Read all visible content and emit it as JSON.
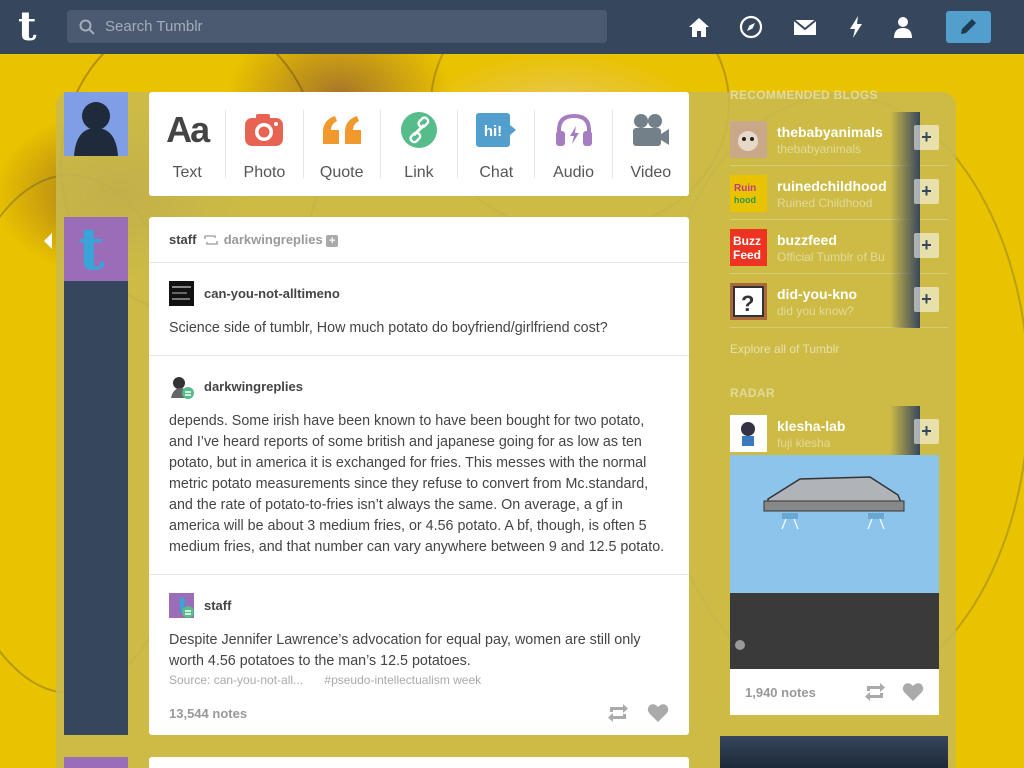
{
  "header": {
    "logo": "t",
    "search_placeholder": "Search Tumblr",
    "nav": [
      "home-icon",
      "explore-icon",
      "inbox-icon",
      "activity-icon",
      "account-icon"
    ],
    "compose": "pencil-icon",
    "bg_color": "#36465d",
    "accent": "#529ecc"
  },
  "post_types": [
    {
      "label": "Text",
      "icon": "text-icon",
      "color": "#444444"
    },
    {
      "label": "Photo",
      "icon": "photo-icon",
      "color": "#e86452"
    },
    {
      "label": "Quote",
      "icon": "quote-icon",
      "color": "#f2992e"
    },
    {
      "label": "Link",
      "icon": "link-icon",
      "color": "#56bc8a"
    },
    {
      "label": "Chat",
      "icon": "chat-icon",
      "color": "#529ecc"
    },
    {
      "label": "Audio",
      "icon": "audio-icon",
      "color": "#a77dc2"
    },
    {
      "label": "Video",
      "icon": "video-icon",
      "color": "#748089"
    }
  ],
  "post": {
    "author": "staff",
    "reblogged_from": "darkwingreplies",
    "trail": [
      {
        "name": "can-you-not-alltimeno",
        "body": "Science side of tumblr, How much potato do boyfriend/girlfriend cost?"
      },
      {
        "name": "darkwingreplies",
        "body": "depends. Some irish have been known to have been bought for two potato, and I’ve heard reports of some british and japanese going for as low as ten potato, but in america it is exchanged for fries. This messes with the normal metric potato measurements since they refuse to convert from Mc.standard, and the rate of potato-to-fries isn’t always the same. On average, a gf in america will be about 3 medium fries, or 4.56 potato. A bf, though, is often 5 medium fries, and that number can vary anywhere between 9 and 12.5 potato."
      },
      {
        "name": "staff",
        "body": "Despite Jennifer Lawrence’s advocation for equal pay, women are still only worth 4.56 potatoes to the man’s 12.5 potatoes."
      }
    ],
    "source": "Source: can-you-not-all...",
    "tag": "#pseudo-intellectualism week",
    "notes": "13,544 notes"
  },
  "sidebar": {
    "recommended_title": "RECOMMENDED BLOGS",
    "blogs": [
      {
        "name": "thebabyanimals",
        "sub": "thebabyanimals"
      },
      {
        "name": "ruinedchildhood",
        "sub": "Ruined Childhood"
      },
      {
        "name": "buzzfeed",
        "sub": "Official Tumblr of Bu"
      },
      {
        "name": "did-you-kno",
        "sub": "did you know?"
      }
    ],
    "follow_label": "+",
    "explore": "Explore all of Tumblr",
    "radar_title": "RADAR",
    "radar": {
      "name": "klesha-lab",
      "sub": "fuji klesha",
      "notes": "1,940 notes"
    }
  }
}
